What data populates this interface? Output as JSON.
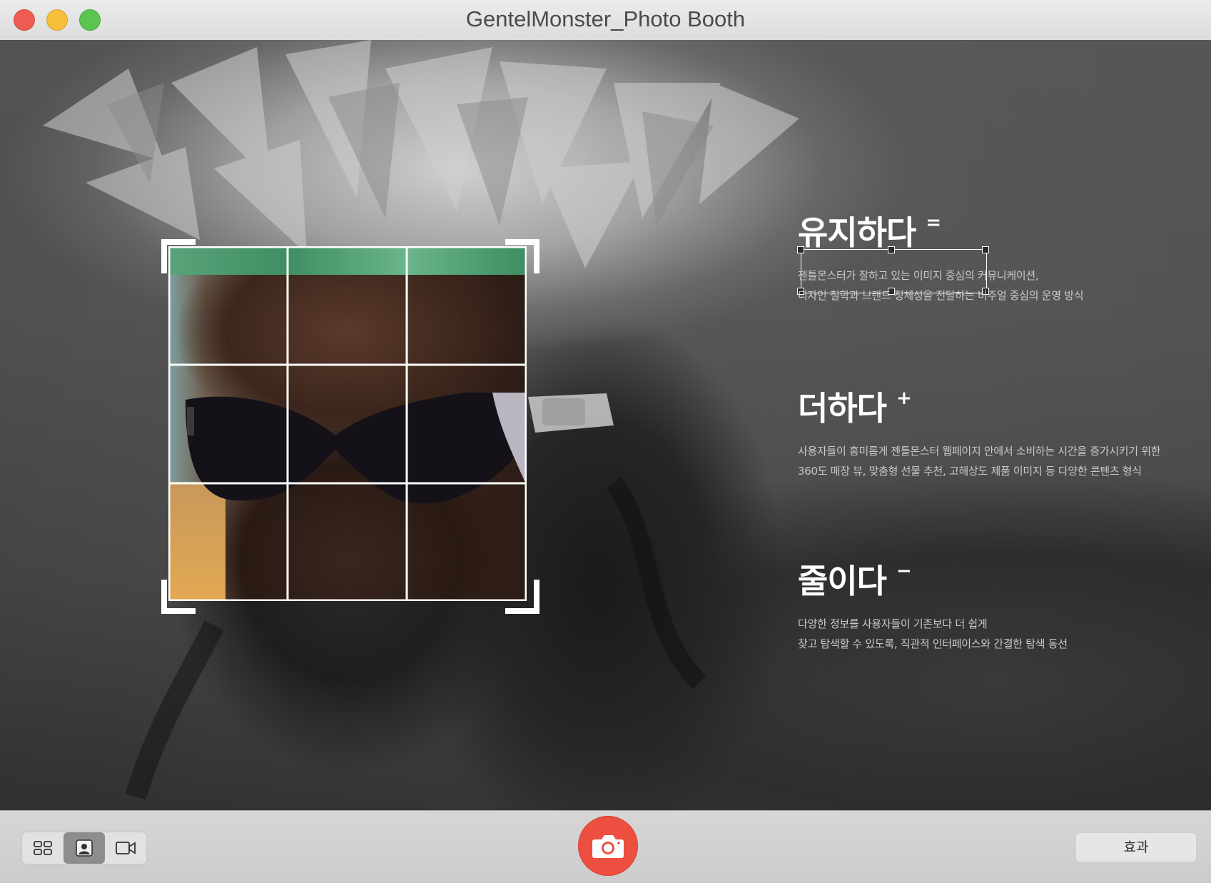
{
  "window": {
    "title": "GentelMonster_Photo Booth"
  },
  "sections": [
    {
      "headline": "유지하다",
      "symbol": "=",
      "lines": [
        "젠틀몬스터가 잘하고 있는 이미지 중심의 커뮤니케이션,",
        "디자인 철학과 브랜드 정체성을 전달하는 비주얼 중심의 운영 방식"
      ]
    },
    {
      "headline": "더하다",
      "symbol": "+",
      "lines": [
        "사용자들이 흥미롭게 젠틀몬스터 웹페이지 안에서 소비하는 시간을 증가시키기 위한",
        "360도 매장 뷰, 맞춤형 선물 추천, 고해상도 제품 이미지 등 다양한 콘텐츠 형식"
      ]
    },
    {
      "headline": "줄이다",
      "symbol": "−",
      "lines": [
        "다양한 정보를 사용자들이 기존보다 더 쉽게",
        "찾고 탐색할 수 있도록, 직관적 인터페이스와 간결한 탐색 동선"
      ]
    }
  ],
  "toolbar": {
    "view_modes": [
      "grid-view-icon",
      "photo-icon",
      "video-icon"
    ],
    "active_mode": "photo-icon",
    "effects_label": "효과"
  },
  "colors": {
    "shutter": "#ec4f3f",
    "close": "#ee5d54",
    "minimize": "#f6be3a",
    "maximize": "#5cc451"
  }
}
